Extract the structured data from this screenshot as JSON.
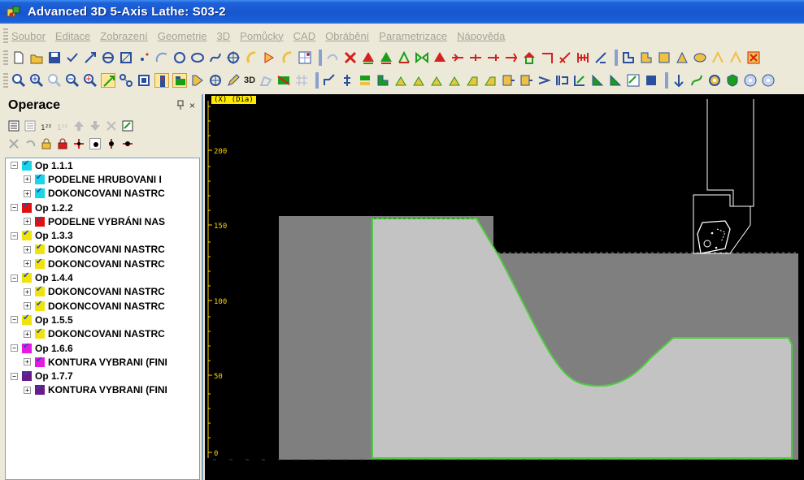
{
  "window": {
    "title": "Advanced 3D 5-Axis Lathe: S03-2"
  },
  "menu": [
    "Soubor",
    "Editace",
    "Zobrazení",
    "Geometrie",
    "3D",
    "Pomůcky",
    "CAD",
    "Obrábění",
    "Parametrizace",
    "Nápověda"
  ],
  "toolbar2": {
    "label_3d": "3D"
  },
  "panel": {
    "title": "Operace",
    "pin_icon": "pin-icon",
    "close_label": "×",
    "tree": [
      {
        "label": "Op 1.1.1",
        "level": 0,
        "color": "#19d6e6"
      },
      {
        "label": "PODELNE HRUBOVANI  I",
        "level": 1,
        "color": "#19d6e6"
      },
      {
        "label": "DOKONCOVANI  NASTRC",
        "level": 1,
        "color": "#19d6e6"
      },
      {
        "label": "Op 1.2.2",
        "level": 0,
        "color": "#e01010"
      },
      {
        "label": "PODELNE VYBRÁNI  NAS",
        "level": 1,
        "color": "#e01010"
      },
      {
        "label": "Op 1.3.3",
        "level": 0,
        "color": "#f1e20a"
      },
      {
        "label": "DOKONCOVANI  NASTRC",
        "level": 1,
        "color": "#f1e20a"
      },
      {
        "label": "DOKONCOVANI  NASTRC",
        "level": 1,
        "color": "#f1e20a"
      },
      {
        "label": "Op 1.4.4",
        "level": 0,
        "color": "#f1e20a"
      },
      {
        "label": "DOKONCOVANI  NASTRC",
        "level": 1,
        "color": "#f1e20a"
      },
      {
        "label": "DOKONCOVANI  NASTRC",
        "level": 1,
        "color": "#f1e20a"
      },
      {
        "label": "Op 1.5.5",
        "level": 0,
        "color": "#f1e20a"
      },
      {
        "label": "DOKONCOVANI  NASTRC",
        "level": 1,
        "color": "#f1e20a"
      },
      {
        "label": "Op 1.6.6",
        "level": 0,
        "color": "#e21ae2"
      },
      {
        "label": "KONTURA VYBRANI (FINI",
        "level": 1,
        "color": "#e21ae2"
      },
      {
        "label": "Op 1.7.7",
        "level": 0,
        "color": "#6a1a8a"
      },
      {
        "label": "KONTURA VYBRANI (FINI",
        "level": 1,
        "color": "#6a1a8a"
      }
    ]
  },
  "viewport": {
    "axis_label": "(X)  (Dia)",
    "y_ticks": [
      "200",
      "150",
      "100",
      "50",
      "0"
    ],
    "colors": {
      "stock": "#7f7f7f",
      "part": "#c3c3c3",
      "contour": "#4dcc3e",
      "background": "#000000"
    }
  }
}
